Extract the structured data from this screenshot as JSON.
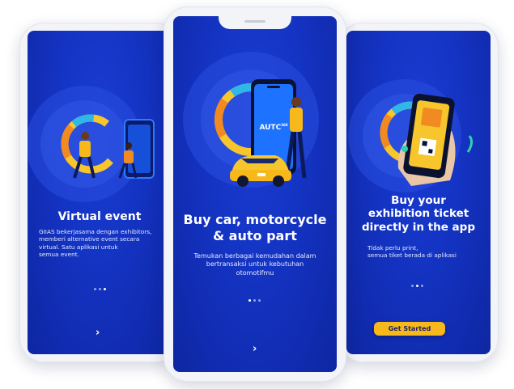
{
  "screens": [
    {
      "title": "Virtual event",
      "description": "GIIAS bekerjasama dengan exhibitors,\nmemberi alternative event secara\nvirtual. Satu aplikasi untuk\nsemua event.",
      "next_icon": "chevron-right-icon",
      "page_indicator": {
        "total": 3,
        "active": 3
      }
    },
    {
      "title": "Buy car, motorcycle\n& auto part",
      "description": "Temukan berbagai kemudahan dalam\nbertransaksi untuk kebutuhan\notomotifmu",
      "phone_logo": "AUTC",
      "phone_logo_sup": "360",
      "next_icon": "chevron-right-icon",
      "page_indicator": {
        "total": 3,
        "active": 1
      }
    },
    {
      "title": "Buy your\nexhibition ticket\ndirectly in the app",
      "description": "Tidak perlu print,\nsemua tiket berada di aplikasi",
      "cta_label": "Get Started",
      "page_indicator": {
        "total": 3,
        "active": 2
      }
    }
  ],
  "colors": {
    "background": "#1434c4",
    "accent": "#f6b81a",
    "ring_orange": "#f28a22",
    "ring_yellow": "#f7c52c"
  }
}
